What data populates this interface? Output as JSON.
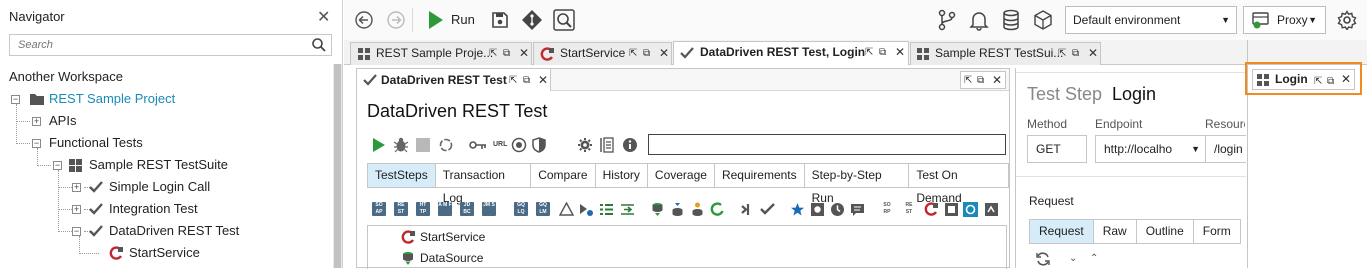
{
  "navigator": {
    "title": "Navigator",
    "search_placeholder": "Search",
    "workspace": "Another Workspace",
    "tree": [
      {
        "label": "REST Sample Project",
        "icon": "folder-icon",
        "level": 0,
        "expander": "minus",
        "highlight": true
      },
      {
        "label": "APIs",
        "icon": "",
        "level": 1,
        "expander": "plus",
        "highlight": false
      },
      {
        "label": "Functional Tests",
        "icon": "",
        "level": 1,
        "expander": "minus",
        "highlight": false
      },
      {
        "label": "Sample REST TestSuite",
        "icon": "grid-icon",
        "level": 2,
        "expander": "minus",
        "highlight": false
      },
      {
        "label": "Simple Login Call",
        "icon": "check-icon",
        "level": 3,
        "expander": "plus",
        "highlight": false
      },
      {
        "label": "Integration Test",
        "icon": "check-icon",
        "level": 3,
        "expander": "plus",
        "highlight": false
      },
      {
        "label": "DataDriven REST Test",
        "icon": "check-icon",
        "level": 3,
        "expander": "minus",
        "highlight": false
      },
      {
        "label": "StartService",
        "icon": "rest-request-icon",
        "level": 4,
        "expander": "",
        "highlight": false
      }
    ]
  },
  "toolbar": {
    "run_label": "Run",
    "environment": "Default environment",
    "proxy_label": "Proxy"
  },
  "editor_tabs": [
    {
      "label": "REST Sample Proje...",
      "icon": "grid-icon",
      "active": false
    },
    {
      "label": "StartService",
      "icon": "rest-request-icon",
      "active": false
    },
    {
      "label": "DataDriven REST Test, Login",
      "icon": "check-icon",
      "active": true
    },
    {
      "label": "Sample REST TestSui...",
      "icon": "grid-icon",
      "active": false
    }
  ],
  "inner_tab": {
    "label": "DataDriven REST Test",
    "icon": "check-icon"
  },
  "test_case": {
    "title": "DataDriven REST Test",
    "url_badge": "URL",
    "subtabs": [
      {
        "label": "TestSteps",
        "active": true
      },
      {
        "label": "Transaction Log",
        "active": false
      },
      {
        "label": "Compare",
        "active": false
      },
      {
        "label": "History",
        "active": false
      },
      {
        "label": "Coverage",
        "active": false
      },
      {
        "label": "Requirements",
        "active": false
      },
      {
        "label": "Step-by-Step Run",
        "active": false
      },
      {
        "label": "Test On Demand",
        "active": false
      }
    ],
    "step_tool_icons": [
      {
        "text": "SO AP",
        "color": "#4a6a86"
      },
      {
        "text": "RE ST",
        "color": "#4a6a86"
      },
      {
        "text": "HT TP",
        "color": "#4a6a86"
      },
      {
        "text": "A M F",
        "color": "#4a6a86"
      },
      {
        "text": "JD BC",
        "color": "#4a6a86"
      },
      {
        "text": "JM S",
        "color": "#4a6a86"
      },
      {
        "text": "GQ LQ",
        "color": "#4a6a86"
      },
      {
        "text": "GQ LM",
        "color": "#4a6a86"
      }
    ],
    "steps": [
      {
        "label": "StartService",
        "icon": "rest-request-icon"
      },
      {
        "label": "DataSource",
        "icon": "datasource-icon"
      }
    ]
  },
  "test_step": {
    "prefix": "Test Step",
    "name": "Login",
    "method_label": "Method",
    "method_value": "GET",
    "endpoint_label": "Endpoint",
    "endpoint_value": "http://localho",
    "resource_label": "Resource",
    "resource_value": "/login",
    "request_label": "Request",
    "request_tabs": [
      {
        "label": "Request",
        "active": true
      },
      {
        "label": "Raw",
        "active": false
      },
      {
        "label": "Outline",
        "active": false
      },
      {
        "label": "Form",
        "active": false
      }
    ]
  },
  "login_tab": {
    "label": "Login"
  },
  "colors": {
    "accent_blue": "#1a8bb9",
    "run_green": "#2c9a3a",
    "highlight_orange": "#f08c1a",
    "selected_tab": "#d6ecf8"
  }
}
